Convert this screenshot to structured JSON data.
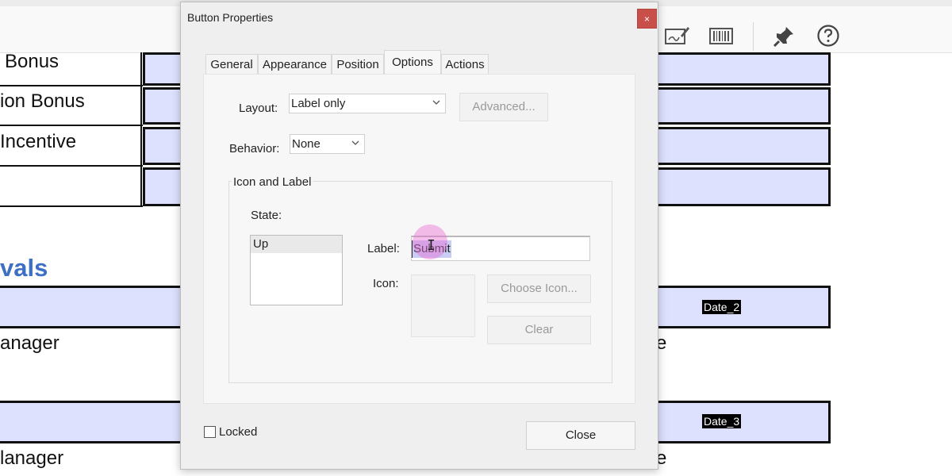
{
  "background": {
    "toolbar": {
      "icons": [
        "sign-icon",
        "barcode-icon",
        "pin-icon",
        "help-icon"
      ]
    },
    "row_labels": [
      "Bonus",
      "ion Bonus",
      "Incentive"
    ],
    "section_heading": "vals",
    "manager_labels": [
      "anager",
      "lanager"
    ],
    "right_fragments": [
      "e",
      "e"
    ],
    "date_fields": [
      "Date_2",
      "Date_3"
    ],
    "colors": {
      "field_fill": "#dde1fd",
      "heading": "#3d6fc4"
    }
  },
  "dialog": {
    "title": "Button Properties",
    "close_glyph": "×",
    "tabs": [
      {
        "label": "General",
        "active": false
      },
      {
        "label": "Appearance",
        "active": false
      },
      {
        "label": "Position",
        "active": false
      },
      {
        "label": "Options",
        "active": true
      },
      {
        "label": "Actions",
        "active": false
      }
    ],
    "layout": {
      "label": "Layout:",
      "value": "Label only",
      "advanced_button": "Advanced..."
    },
    "behavior": {
      "label": "Behavior:",
      "value": "None"
    },
    "icon_and_label": {
      "group_title": "Icon and Label",
      "state_label": "State:",
      "states": [
        "Up"
      ],
      "label_field_label": "Label:",
      "label_value": "Submit",
      "icon_label": "Icon:",
      "choose_icon_button": "Choose Icon...",
      "clear_button": "Clear"
    },
    "locked": {
      "label": "Locked",
      "checked": false
    },
    "close_button": "Close",
    "colors": {
      "close_x_bg": "#c9504a",
      "selection": "#c9cdf5",
      "cursor_highlight": "#e86ed2"
    }
  }
}
